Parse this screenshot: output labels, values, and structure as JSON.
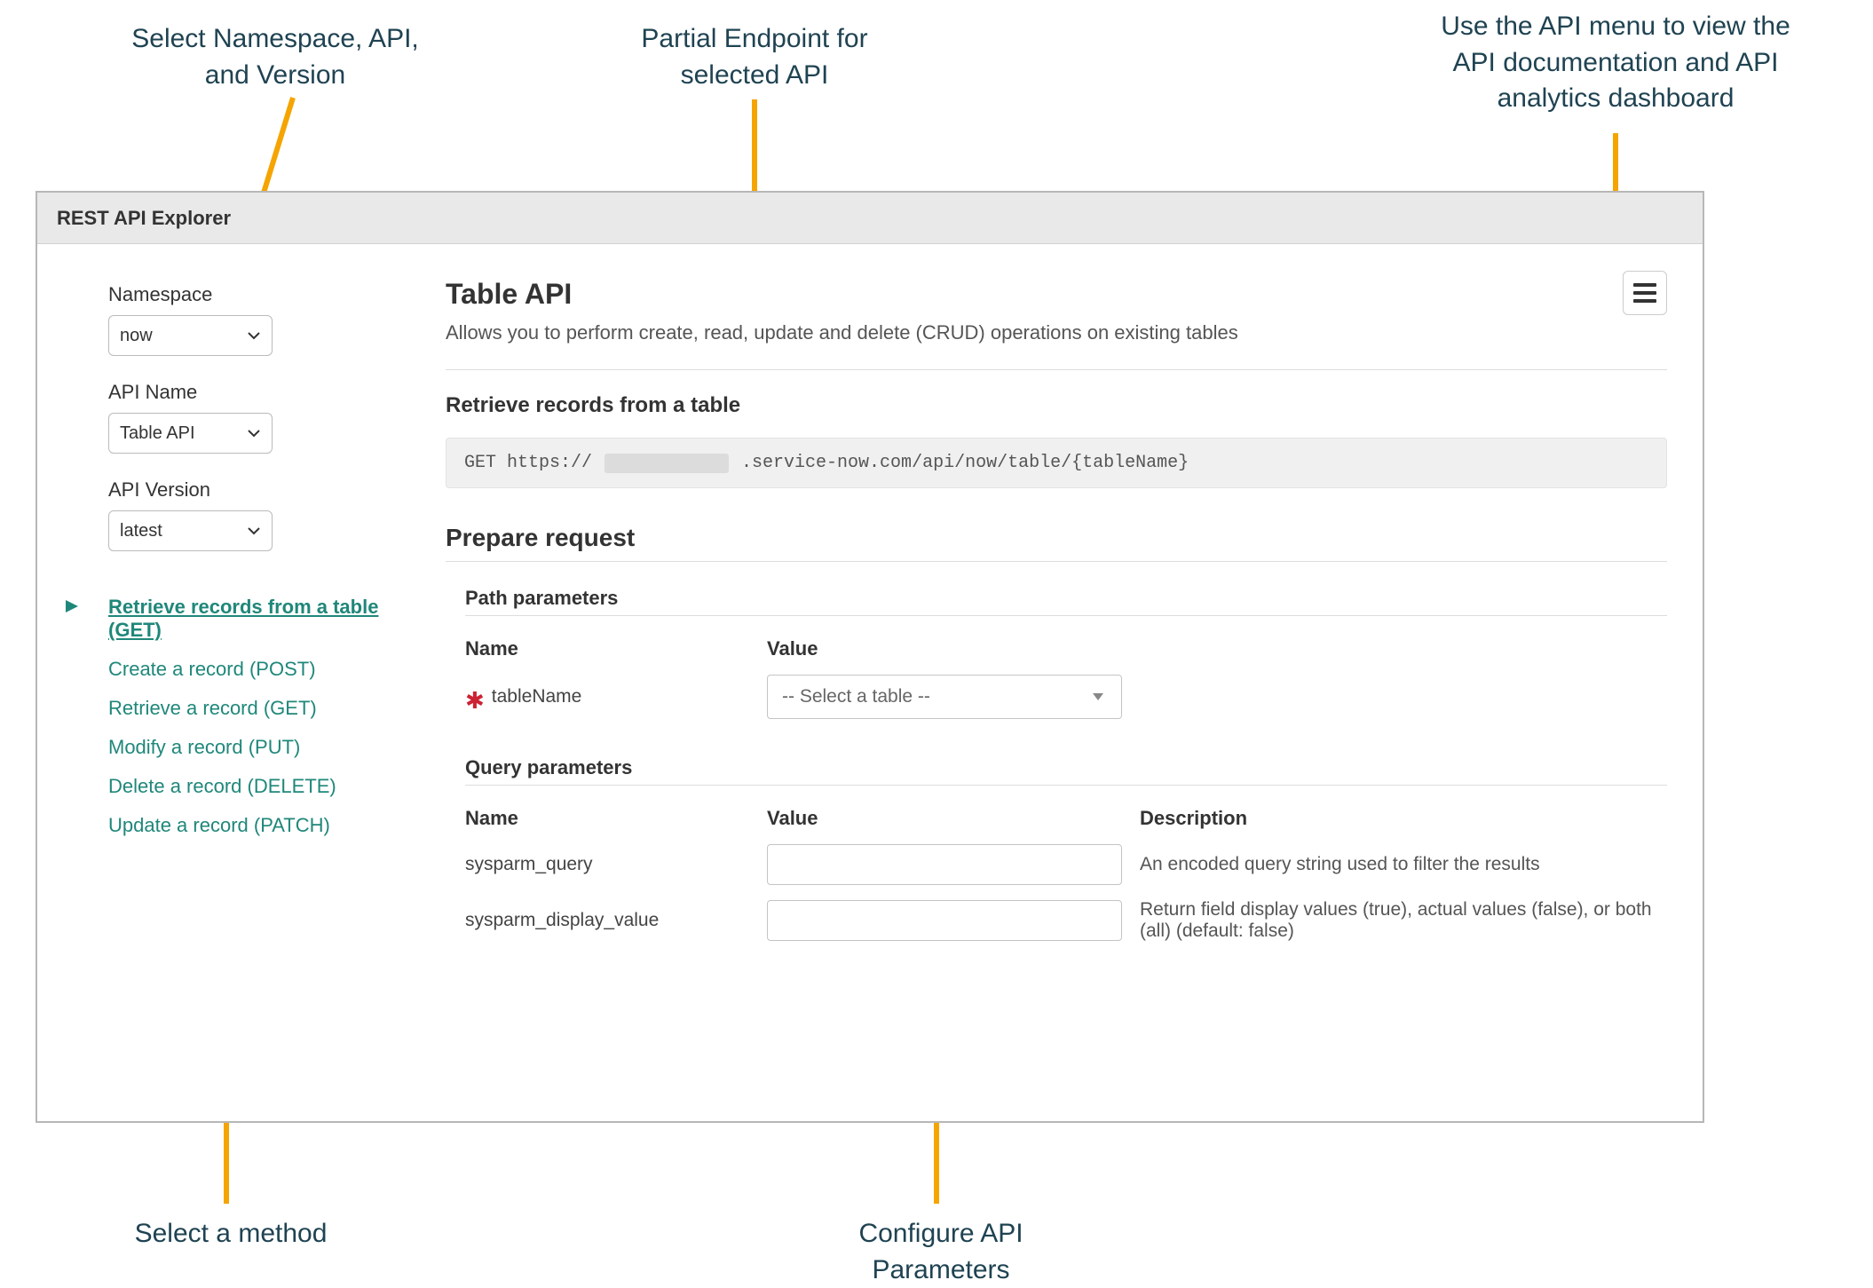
{
  "annotations": {
    "top_left": "Select Namespace, API,\nand Version",
    "top_center": "Partial Endpoint for\nselected API",
    "top_right": "Use the API menu to view the\nAPI documentation and API\nanalytics dashboard",
    "bottom_left": "Select a method",
    "bottom_center": "Configure API\nParameters"
  },
  "app": {
    "title": "REST API Explorer"
  },
  "sidebar": {
    "namespace_label": "Namespace",
    "namespace_value": "now",
    "api_name_label": "API Name",
    "api_name_value": "Table API",
    "api_version_label": "API Version",
    "api_version_value": "latest",
    "methods": [
      {
        "label": "Retrieve records from a table  (GET)",
        "active": true
      },
      {
        "label": "Create a record  (POST)",
        "active": false
      },
      {
        "label": "Retrieve a record  (GET)",
        "active": false
      },
      {
        "label": "Modify a record  (PUT)",
        "active": false
      },
      {
        "label": "Delete a record  (DELETE)",
        "active": false
      },
      {
        "label": "Update a record  (PATCH)",
        "active": false
      }
    ]
  },
  "main": {
    "api_title": "Table API",
    "api_desc": "Allows you to perform create, read, update and delete (CRUD) operations on existing tables",
    "retrieve_title": "Retrieve records from a table",
    "endpoint_prefix": "GET https://",
    "endpoint_suffix": ".service-now.com/api/now/table/{tableName}",
    "prepare_title": "Prepare request",
    "path_params_title": "Path parameters",
    "path_headers": {
      "name": "Name",
      "value": "Value"
    },
    "path_param_name": "tableName",
    "path_param_placeholder": "-- Select a table --",
    "query_params_title": "Query parameters",
    "query_headers": {
      "name": "Name",
      "value": "Value",
      "desc": "Description"
    },
    "query_params": [
      {
        "name": "sysparm_query",
        "desc": "An encoded query string used to filter the results"
      },
      {
        "name": "sysparm_display_value",
        "desc": "Return field display values (true), actual values (false), or both (all) (default: false)"
      }
    ]
  }
}
